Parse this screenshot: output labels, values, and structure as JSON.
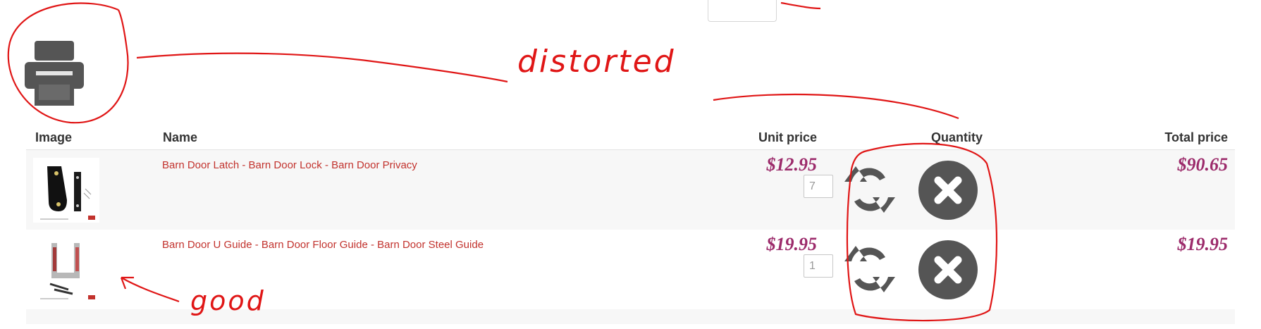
{
  "table": {
    "headers": {
      "image": "Image",
      "name": "Name",
      "unit_price": "Unit price",
      "quantity": "Quantity",
      "total_price": "Total price"
    },
    "rows": [
      {
        "name": "Barn Door Latch - Barn Door Lock - Barn Door Privacy",
        "unit_price": "$12.95",
        "quantity": "7",
        "total_price": "$90.65"
      },
      {
        "name": "Barn Door U Guide - Barn Door Floor Guide - Barn Door Steel Guide",
        "unit_price": "$19.95",
        "quantity": "1",
        "total_price": "$19.95"
      }
    ]
  },
  "icons": {
    "print": "printer-icon",
    "update": "refresh-icon",
    "remove": "remove-icon"
  },
  "annotations": {
    "distorted_label": "distorted",
    "good_label": "good"
  },
  "colors": {
    "link": "#c2322d",
    "price": "#9c2b6b",
    "icon": "#555555",
    "annotation": "#e01616",
    "row_band": "#f7f7f7"
  }
}
